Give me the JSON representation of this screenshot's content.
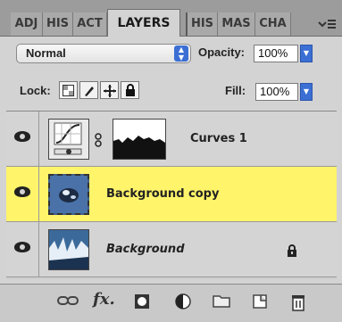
{
  "tabs": [
    {
      "label": "ADJ"
    },
    {
      "label": "HIS"
    },
    {
      "label": "ACT"
    },
    {
      "label": "LAYERS"
    },
    {
      "label": "HIS"
    },
    {
      "label": "MAS"
    },
    {
      "label": "CHA"
    }
  ],
  "blend_mode": {
    "value": "Normal"
  },
  "opacity": {
    "label": "Opacity:",
    "value": "100%"
  },
  "lock": {
    "label": "Lock:"
  },
  "fill": {
    "label": "Fill:",
    "value": "100%"
  },
  "layers": [
    {
      "name": "Curves 1"
    },
    {
      "name": "Background copy"
    },
    {
      "name": "Background"
    }
  ],
  "colors": {
    "selected_row": "#fff46a",
    "accent": "#3b6fd4"
  }
}
